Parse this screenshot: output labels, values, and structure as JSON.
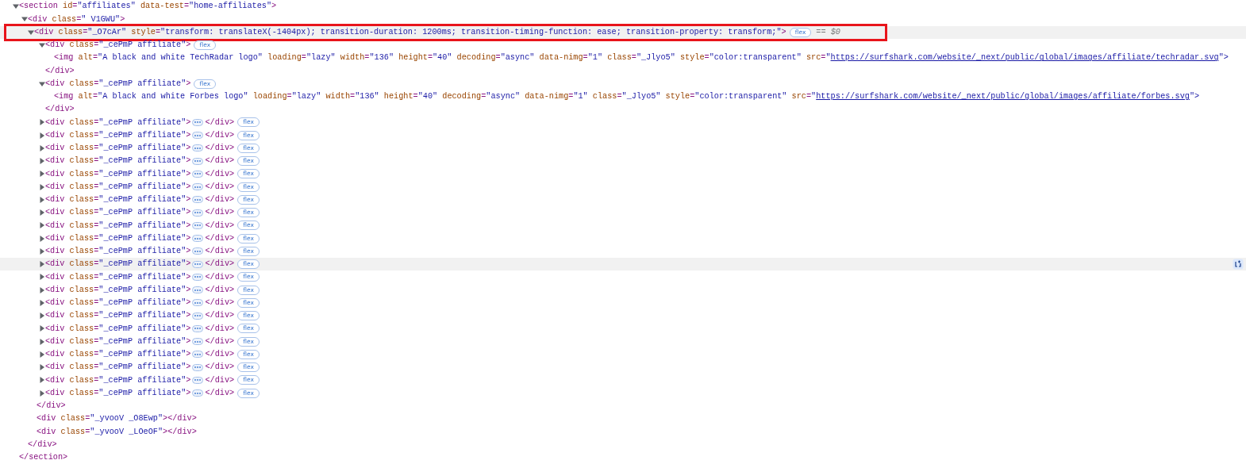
{
  "dom_tree": {
    "kind": "element",
    "expanded": true,
    "selected": false,
    "hovered": false,
    "open": "<section id=\"affiliates\" data-test=\"home-affiliates\">",
    "close": "</section>",
    "children": [
      {
        "kind": "element",
        "expanded": true,
        "selected": false,
        "hovered": false,
        "open": "<div class=\" V1GWU\">",
        "close": "</div>",
        "children": [
          {
            "kind": "element",
            "expanded": true,
            "selected": true,
            "hovered": false,
            "open": "<div class=\"_O7cAr\" style=\"transform: translateX(-1404px); transition-duration: 1200ms; transition-timing-function: ease; transition-property: transform;\">",
            "badge": "flex",
            "marker": "== $0",
            "close": "</div>",
            "children": [
              {
                "kind": "element",
                "expanded": true,
                "selected": false,
                "hovered": false,
                "open": "<div class=\"_cePmP affiliate\">",
                "badge": "flex",
                "close": "</div>",
                "children": [
                  {
                    "kind": "void",
                    "selected": false,
                    "hovered": false,
                    "open": "<img alt=\"A black and white TechRadar logo\" loading=\"lazy\" width=\"136\" height=\"40\" decoding=\"async\" data-nimg=\"1\" class=\"_Jlyo5\" style=\"color:transparent\" src=\"",
                    "link": "https://surfshark.com/website/_next/public/global/images/affiliate/techradar.svg",
                    "open_end": "\">"
                  }
                ]
              },
              {
                "kind": "element",
                "expanded": true,
                "selected": false,
                "hovered": false,
                "open": "<div class=\"_cePmP affiliate\">",
                "badge": "flex",
                "close": "</div>",
                "children": [
                  {
                    "kind": "void",
                    "selected": false,
                    "hovered": false,
                    "open": "<img alt=\"A black and white Forbes logo\" loading=\"lazy\" width=\"136\" height=\"40\" decoding=\"async\" data-nimg=\"1\" class=\"_Jlyo5\" style=\"color:transparent\" src=\"",
                    "link": "https://surfshark.com/website/_next/public/global/images/affiliate/forbes.svg",
                    "open_end": "\">"
                  }
                ]
              },
              {
                "kind": "element",
                "expanded": false,
                "selected": false,
                "hovered": false,
                "open": "<div class=\"_cePmP affiliate\">",
                "close": "</div>",
                "badge": "flex"
              },
              {
                "kind": "element",
                "expanded": false,
                "selected": false,
                "hovered": false,
                "open": "<div class=\"_cePmP affiliate\">",
                "close": "</div>",
                "badge": "flex"
              },
              {
                "kind": "element",
                "expanded": false,
                "selected": false,
                "hovered": false,
                "open": "<div class=\"_cePmP affiliate\">",
                "close": "</div>",
                "badge": "flex"
              },
              {
                "kind": "element",
                "expanded": false,
                "selected": false,
                "hovered": false,
                "open": "<div class=\"_cePmP affiliate\">",
                "close": "</div>",
                "badge": "flex"
              },
              {
                "kind": "element",
                "expanded": false,
                "selected": false,
                "hovered": false,
                "open": "<div class=\"_cePmP affiliate\">",
                "close": "</div>",
                "badge": "flex"
              },
              {
                "kind": "element",
                "expanded": false,
                "selected": false,
                "hovered": false,
                "open": "<div class=\"_cePmP affiliate\">",
                "close": "</div>",
                "badge": "flex"
              },
              {
                "kind": "element",
                "expanded": false,
                "selected": false,
                "hovered": false,
                "open": "<div class=\"_cePmP affiliate\">",
                "close": "</div>",
                "badge": "flex"
              },
              {
                "kind": "element",
                "expanded": false,
                "selected": false,
                "hovered": false,
                "open": "<div class=\"_cePmP affiliate\">",
                "close": "</div>",
                "badge": "flex"
              },
              {
                "kind": "element",
                "expanded": false,
                "selected": false,
                "hovered": false,
                "open": "<div class=\"_cePmP affiliate\">",
                "close": "</div>",
                "badge": "flex"
              },
              {
                "kind": "element",
                "expanded": false,
                "selected": false,
                "hovered": false,
                "open": "<div class=\"_cePmP affiliate\">",
                "close": "</div>",
                "badge": "flex"
              },
              {
                "kind": "element",
                "expanded": false,
                "selected": false,
                "hovered": false,
                "open": "<div class=\"_cePmP affiliate\">",
                "close": "</div>",
                "badge": "flex"
              },
              {
                "kind": "element",
                "expanded": false,
                "selected": false,
                "hovered": true,
                "open": "<div class=\"_cePmP affiliate\">",
                "close": "</div>",
                "badge": "flex"
              },
              {
                "kind": "element",
                "expanded": false,
                "selected": false,
                "hovered": false,
                "open": "<div class=\"_cePmP affiliate\">",
                "close": "</div>",
                "badge": "flex"
              },
              {
                "kind": "element",
                "expanded": false,
                "selected": false,
                "hovered": false,
                "open": "<div class=\"_cePmP affiliate\">",
                "close": "</div>",
                "badge": "flex"
              },
              {
                "kind": "element",
                "expanded": false,
                "selected": false,
                "hovered": false,
                "open": "<div class=\"_cePmP affiliate\">",
                "close": "</div>",
                "badge": "flex"
              },
              {
                "kind": "element",
                "expanded": false,
                "selected": false,
                "hovered": false,
                "open": "<div class=\"_cePmP affiliate\">",
                "close": "</div>",
                "badge": "flex"
              },
              {
                "kind": "element",
                "expanded": false,
                "selected": false,
                "hovered": false,
                "open": "<div class=\"_cePmP affiliate\">",
                "close": "</div>",
                "badge": "flex"
              },
              {
                "kind": "element",
                "expanded": false,
                "selected": false,
                "hovered": false,
                "open": "<div class=\"_cePmP affiliate\">",
                "close": "</div>",
                "badge": "flex"
              },
              {
                "kind": "element",
                "expanded": false,
                "selected": false,
                "hovered": false,
                "open": "<div class=\"_cePmP affiliate\">",
                "close": "</div>",
                "badge": "flex"
              },
              {
                "kind": "element",
                "expanded": false,
                "selected": false,
                "hovered": false,
                "open": "<div class=\"_cePmP affiliate\">",
                "close": "</div>",
                "badge": "flex"
              },
              {
                "kind": "element",
                "expanded": false,
                "selected": false,
                "hovered": false,
                "open": "<div class=\"_cePmP affiliate\">",
                "close": "</div>",
                "badge": "flex"
              },
              {
                "kind": "element",
                "expanded": false,
                "selected": false,
                "hovered": false,
                "open": "<div class=\"_cePmP affiliate\">",
                "close": "</div>",
                "badge": "flex"
              }
            ]
          },
          {
            "kind": "empty",
            "selected": false,
            "hovered": false,
            "open": "<div class=\"_yvooV _O8Ewp\"></div>"
          },
          {
            "kind": "empty",
            "selected": false,
            "hovered": false,
            "open": "<div class=\"_yvooV _LOeOF\"></div>"
          }
        ]
      }
    ]
  }
}
